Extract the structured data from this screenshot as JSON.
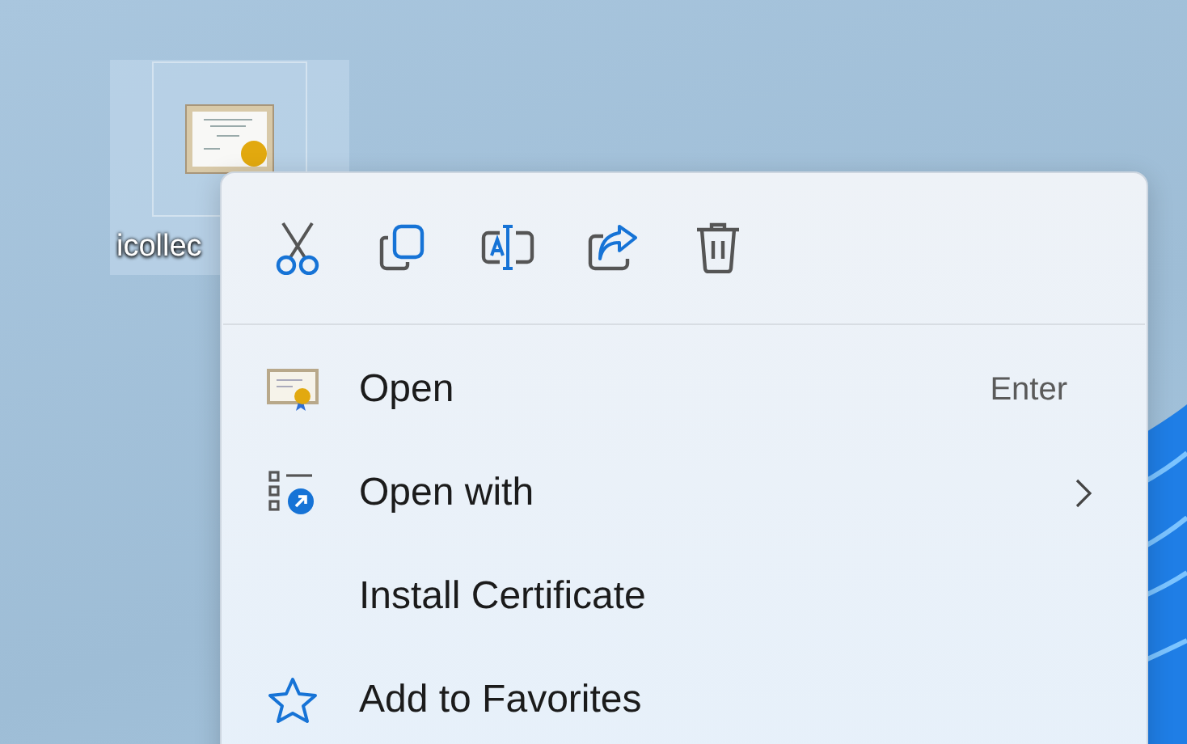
{
  "desktop_icon": {
    "label": "icollec",
    "selected": true
  },
  "context_menu": {
    "items": [
      {
        "label": "Open",
        "shortcut": "Enter",
        "has_submenu": false
      },
      {
        "label": "Open with",
        "has_submenu": true
      },
      {
        "label": "Install Certificate",
        "has_submenu": false
      },
      {
        "label": "Add to Favorites",
        "has_submenu": false
      }
    ]
  }
}
